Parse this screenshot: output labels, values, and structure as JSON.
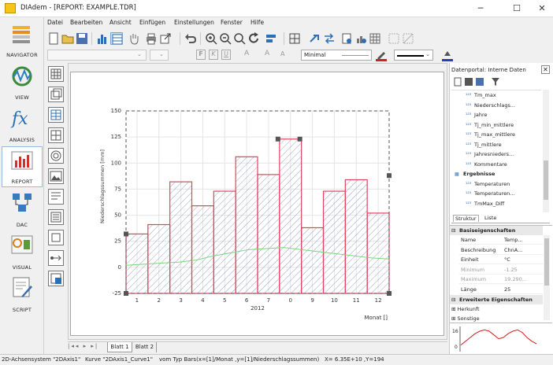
{
  "window": {
    "title": "DIAdem - [REPORT:  EXAMPLE.TDR]"
  },
  "nav": [
    {
      "id": "navigator",
      "label": "NAVIGATOR"
    },
    {
      "id": "view",
      "label": "VIEW"
    },
    {
      "id": "analysis",
      "label": "ANALYSIS"
    },
    {
      "id": "report",
      "label": "REPORT"
    },
    {
      "id": "dac",
      "label": "DAC"
    },
    {
      "id": "visual",
      "label": "VISUAL"
    },
    {
      "id": "script",
      "label": "SCRIPT"
    }
  ],
  "menu": [
    "Datei",
    "Bearbeiten",
    "Ansicht",
    "Einfügen",
    "Einstellungen",
    "Fenster",
    "Hilfe"
  ],
  "toolbar2": {
    "line_style": "Minimal"
  },
  "sheets": [
    "Blatt 1",
    "Blatt 2"
  ],
  "datapanel": {
    "title": "Datenportal: Interne Daten",
    "tree": [
      {
        "label": "Tm_max",
        "indent": 1
      },
      {
        "label": "Niederschlags...",
        "indent": 1
      },
      {
        "label": "Jahre",
        "indent": 1
      },
      {
        "label": "Tj_min_mittlere",
        "indent": 1
      },
      {
        "label": "Tj_max_mittlere",
        "indent": 1
      },
      {
        "label": "Tj_mittlere",
        "indent": 1
      },
      {
        "label": "Jahresnieders...",
        "indent": 1
      },
      {
        "label": "Kommentare",
        "indent": 1
      },
      {
        "label": "Ergebnisse",
        "indent": 0,
        "bold": true
      },
      {
        "label": "Temperaturen",
        "indent": 1
      },
      {
        "label": "Temperaturen...",
        "indent": 1
      },
      {
        "label": "TmMax_Diff",
        "indent": 1
      }
    ],
    "tabs": [
      "Struktur",
      "Liste"
    ]
  },
  "properties": {
    "group_basic": "Basiseigenschaften",
    "rows": [
      {
        "k": "Name",
        "v": "Temp...",
        "muted": false
      },
      {
        "k": "Beschreibung",
        "v": "ChnA...",
        "muted": false
      },
      {
        "k": "Einheit",
        "v": "°C",
        "muted": false
      },
      {
        "k": "Minimum",
        "v": "-1.25",
        "muted": true
      },
      {
        "k": "Maximum",
        "v": "19.290...",
        "muted": true
      },
      {
        "k": "Länge",
        "v": "25",
        "muted": false
      }
    ],
    "group_ext": "Erweiterte Eigenschaften",
    "extra": [
      "Herkunft",
      "Sonstige"
    ],
    "preview_ylabel": "16",
    "preview_y0": "0"
  },
  "chart_data": {
    "type": "bar",
    "categories": [
      1,
      2,
      3,
      4,
      5,
      6,
      7,
      8,
      9,
      10,
      11,
      12
    ],
    "x_tick_labels": [
      "1",
      "2",
      "3",
      "4",
      "5",
      "6",
      "7",
      "0",
      "9",
      "10",
      "11",
      "12"
    ],
    "values": [
      32,
      41,
      82,
      59,
      73,
      106,
      89,
      123,
      38,
      73,
      84,
      52
    ],
    "line_series": [
      2,
      3,
      4,
      5,
      7,
      11,
      14,
      17,
      18,
      19,
      17,
      15,
      13,
      11,
      9,
      8
    ],
    "ylabel": "Niederschlagssummen [mm]",
    "xlabel": "2012",
    "x_unit_label": "Monat []",
    "yticks": [
      0,
      25,
      50,
      75,
      100,
      125,
      150
    ],
    "extra_y_ticks": [
      "-25"
    ],
    "ylim": [
      -25,
      150
    ],
    "xlim": [
      0.5,
      12.5
    ]
  },
  "status": {
    "left": "2D-Achsensystem \"2DAxis1\"",
    "middle": "Kurve \"2DAxis1_Curve1\"",
    "right": "vom Typ Bars(x=[1]/Monat ,y=[1]/Niederschlagssummen)",
    "coords": "X= 6.35E+10 ,Y=194"
  },
  "colors": {
    "bar_edge": "#e0445c",
    "bar_hatch": "#6b77b3",
    "line": "#7ad67a",
    "accent": "#1f5fa8"
  }
}
